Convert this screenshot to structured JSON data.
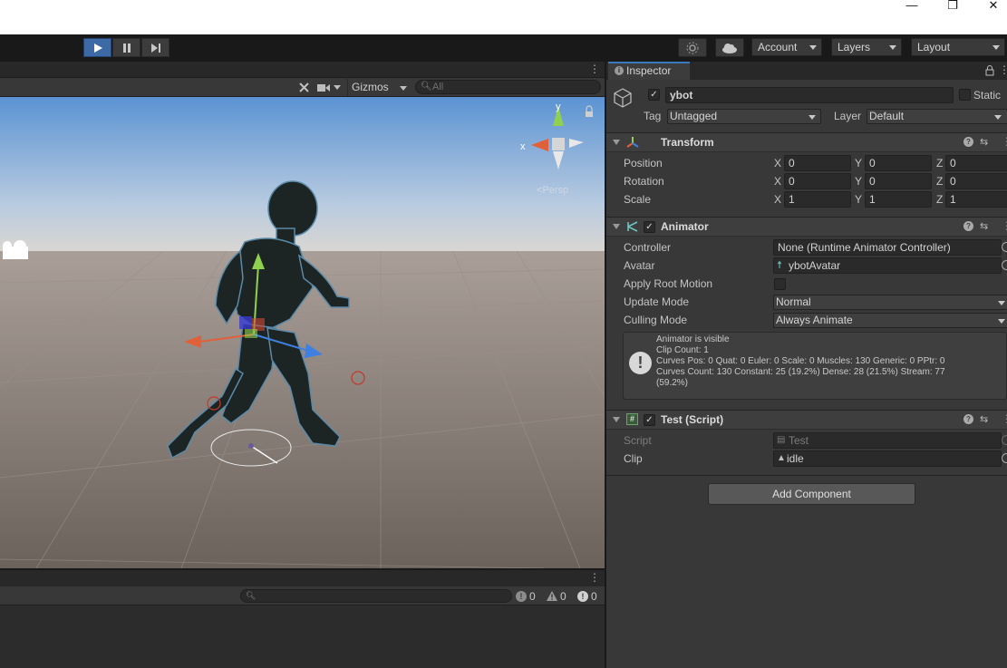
{
  "window": {
    "minimize_glyph": "—",
    "restore_glyph": "❐",
    "close_glyph": "✕"
  },
  "toolbar": {
    "play_icon": "play-icon",
    "pause_icon": "pause-icon",
    "step_icon": "step-icon",
    "account_label": "Account",
    "layers_label": "Layers",
    "layout_label": "Layout"
  },
  "scene": {
    "gizmos_label": "Gizmos",
    "search_placeholder": "All",
    "persp_label": "Persp",
    "axis_y": "y",
    "axis_x": "x"
  },
  "console": {
    "error_count": "0",
    "warning_count": "0",
    "info_count": "0"
  },
  "inspector": {
    "tab_label": "Inspector",
    "object_name": "ybot",
    "static_label": "Static",
    "tag_label": "Tag",
    "tag_value": "Untagged",
    "layer_label": "Layer",
    "layer_value": "Default",
    "transform": {
      "title": "Transform",
      "rows": [
        {
          "label": "Position",
          "x": "0",
          "y": "0",
          "z": "0"
        },
        {
          "label": "Rotation",
          "x": "0",
          "y": "0",
          "z": "0"
        },
        {
          "label": "Scale",
          "x": "1",
          "y": "1",
          "z": "1"
        }
      ],
      "axis_x": "X",
      "axis_y": "Y",
      "axis_z": "Z"
    },
    "animator": {
      "title": "Animator",
      "controller_label": "Controller",
      "controller_value": "None (Runtime Animator Controller)",
      "avatar_label": "Avatar",
      "avatar_value": "ybotAvatar",
      "apply_root_motion_label": "Apply Root Motion",
      "update_mode_label": "Update Mode",
      "update_mode_value": "Normal",
      "culling_mode_label": "Culling Mode",
      "culling_mode_value": "Always Animate",
      "info_lines": [
        "Animator is visible",
        "Clip Count: 1",
        "Curves Pos: 0 Quat: 0 Euler: 0 Scale: 0 Muscles: 130 Generic: 0 PPtr: 0",
        "Curves Count: 130 Constant: 25 (19.2%) Dense: 28 (21.5%) Stream: 77",
        "(59.2%)"
      ]
    },
    "test_script": {
      "title": "Test (Script)",
      "script_label": "Script",
      "script_value": "Test",
      "clip_label": "Clip",
      "clip_value": "idle"
    },
    "add_component_label": "Add Component"
  },
  "colors": {
    "accent": "#3d6aa6",
    "panel": "#383838",
    "field": "#2a2a2a"
  }
}
